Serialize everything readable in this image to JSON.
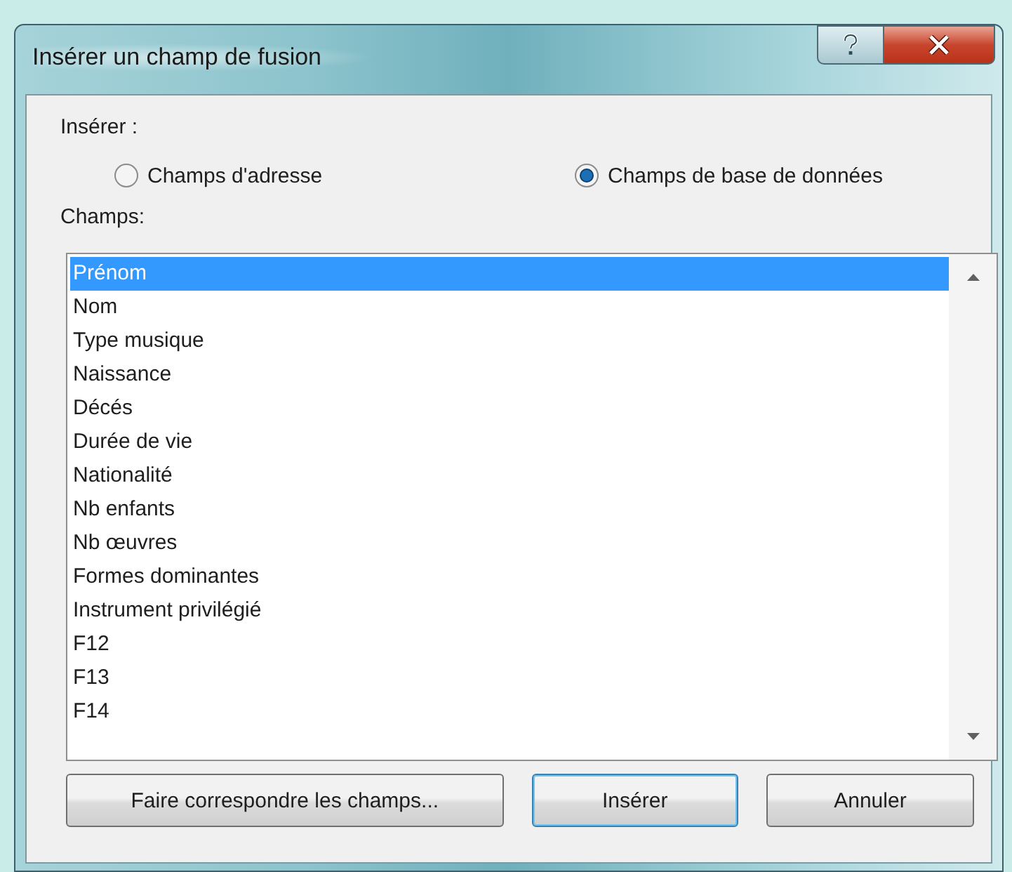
{
  "window": {
    "title": "Insérer un champ de fusion"
  },
  "insert": {
    "label": "Insérer :",
    "options": [
      {
        "label": "Champs d'adresse",
        "selected": false
      },
      {
        "label": "Champs de base de données",
        "selected": true
      }
    ]
  },
  "fields": {
    "label": "Champs:",
    "items": [
      {
        "label": "Prénom",
        "selected": true
      },
      {
        "label": "Nom",
        "selected": false
      },
      {
        "label": "Type musique",
        "selected": false
      },
      {
        "label": "Naissance",
        "selected": false
      },
      {
        "label": "Décés",
        "selected": false
      },
      {
        "label": "Durée de vie",
        "selected": false
      },
      {
        "label": "Nationalité",
        "selected": false
      },
      {
        "label": "Nb enfants",
        "selected": false
      },
      {
        "label": "Nb œuvres",
        "selected": false
      },
      {
        "label": "Formes dominantes",
        "selected": false
      },
      {
        "label": "Instrument privilégié",
        "selected": false
      },
      {
        "label": "F12",
        "selected": false
      },
      {
        "label": "F13",
        "selected": false
      },
      {
        "label": "F14",
        "selected": false
      }
    ]
  },
  "buttons": [
    {
      "label": "Faire correspondre les champs...",
      "default": false
    },
    {
      "label": "Insérer",
      "default": true
    },
    {
      "label": "Annuler",
      "default": false
    }
  ]
}
